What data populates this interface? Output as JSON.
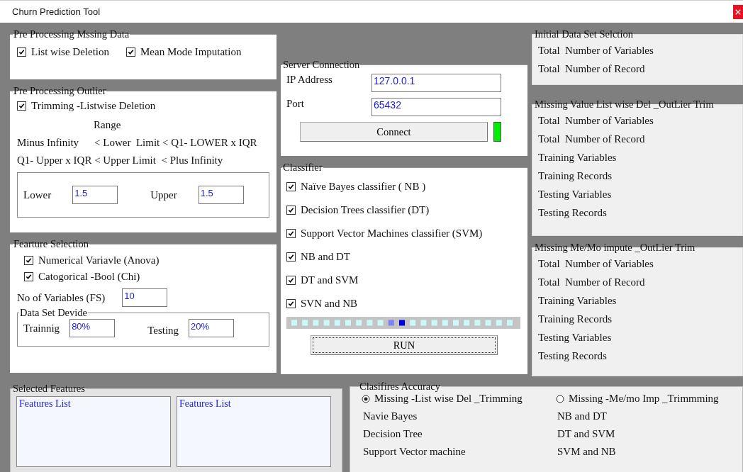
{
  "window": {
    "title": "Churn Prediction Tool"
  },
  "missing_data": {
    "title": "Pre Processing Mssing Data",
    "options": [
      {
        "label": "List wise Deletion",
        "checked": true
      },
      {
        "label": "Mean Mode Imputation",
        "checked": true
      }
    ]
  },
  "outlier": {
    "title": "Pre Processing Outlier",
    "option": {
      "label": "Trimming -Listwise Deletion",
      "checked": true
    },
    "range_label": "Range",
    "formula_1": [
      "Minus Infinity",
      "< Lower  Limit < Q1- LOWER x IQR"
    ],
    "formula_2": "Q1- Upper x IQR < Upper Limit  < Plus Infinity",
    "lower": {
      "label": "Lower",
      "value": "1.5"
    },
    "upper": {
      "label": "Upper",
      "value": "1.5"
    }
  },
  "feature_selection": {
    "title": "Fearture Selection",
    "options": [
      {
        "label": "Numerical Variavle (Anova)",
        "checked": true
      },
      {
        "label": "Catogorical -Bool (Chi)",
        "checked": true
      }
    ],
    "variables": {
      "label": "No of Variables (FS)",
      "value": "10"
    },
    "split": {
      "title": "Data Set Devide",
      "training": {
        "label": "Trainnig",
        "value": "80%"
      },
      "testing": {
        "label": "Testing",
        "value": "20%"
      }
    }
  },
  "server": {
    "title": "Server Connection",
    "ip": {
      "label": "IP Address",
      "value": "127.0.0.1"
    },
    "port": {
      "label": "Port",
      "value": "65432"
    },
    "connect_button": "Connect",
    "connected": true
  },
  "classifier": {
    "title": "Classifier",
    "options": [
      {
        "label": "Naïve Bayes classifier ( NB )",
        "checked": true
      },
      {
        "label": "Decision Trees classifier (DT)",
        "checked": true
      },
      {
        "label": "Support Vector Machines classifier (SVM)",
        "checked": true
      },
      {
        "label": "NB and DT",
        "checked": true
      },
      {
        "label": "DT and SVM",
        "checked": true
      },
      {
        "label": "SVN and NB",
        "checked": true
      }
    ],
    "run_button": "RUN",
    "progress": {
      "level": 0.5
    }
  },
  "stats": [
    {
      "title": "Initial Data Set Selction",
      "rows": [
        "Total  Number of Variables",
        "Total  Number of Record"
      ]
    },
    {
      "title": "Missing Value List wise Del _OutLier Trim",
      "rows": [
        "Total  Number of Variables",
        "Total  Number of Record",
        "Training Variables",
        "Training Records",
        "Testing Variables",
        "Testing Records"
      ]
    },
    {
      "title": "Missing Me/Mo impute _OutLier Trim",
      "rows": [
        "Total  Number of Variables",
        "Total  Number of Record",
        "Training Variables",
        "Training Records",
        "Testing Variables",
        "Testing Records"
      ]
    }
  ],
  "selected_features": {
    "title": "Selected Features",
    "lists": [
      {
        "items": [
          "Features List"
        ]
      },
      {
        "items": [
          "Features List"
        ]
      }
    ]
  },
  "accuracy": {
    "title": "Clasifires Accuracy",
    "modes": [
      {
        "label": "Missing -List wise Del _Trimming",
        "selected": true
      },
      {
        "label": "Missing -Me/mo Imp _Trimmming",
        "selected": false
      }
    ],
    "left": [
      "Navie Bayes",
      "Decision Tree",
      "Support Vector machine"
    ],
    "right": [
      "NB and DT",
      "DT and SVM",
      "SVM and NB"
    ]
  }
}
